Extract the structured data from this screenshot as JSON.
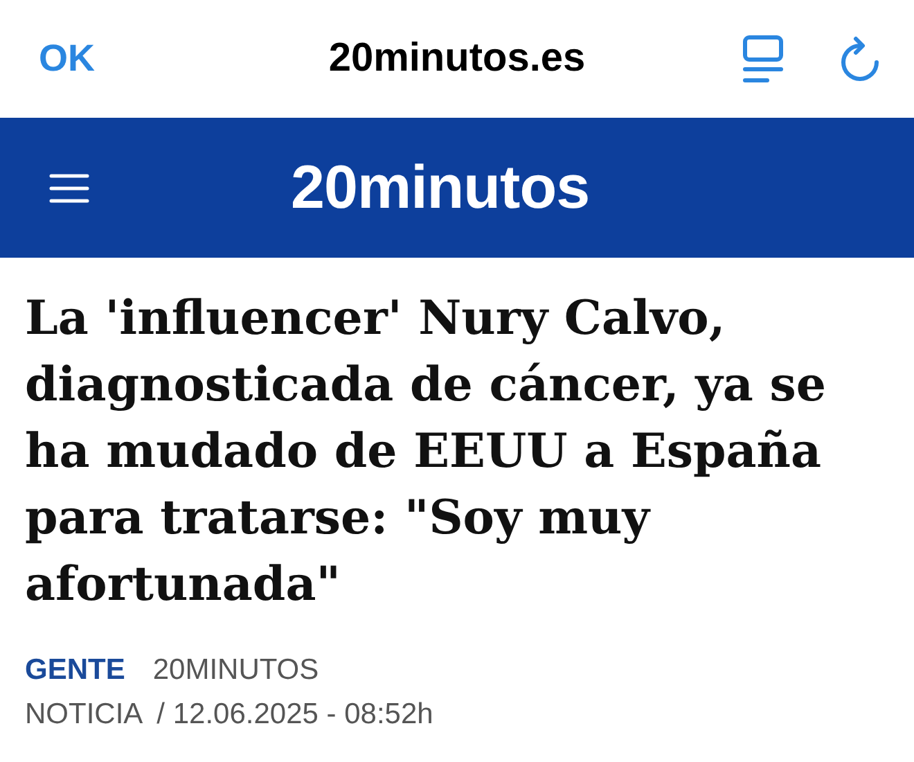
{
  "browser_bar": {
    "done_button": "OK",
    "site": "20minutos.es"
  },
  "site_header": {
    "logo": "20minutos"
  },
  "article": {
    "headline": "La 'influencer' Nury Calvo, diagnosticada de cáncer, ya se ha mudado de EEUU a España para tratarse: \"Soy muy afortunada\"",
    "section": "GENTE",
    "author": "20MINUTOS",
    "type": "NOTICIA",
    "date": "/ 12.06.2025 - 08:52h"
  }
}
